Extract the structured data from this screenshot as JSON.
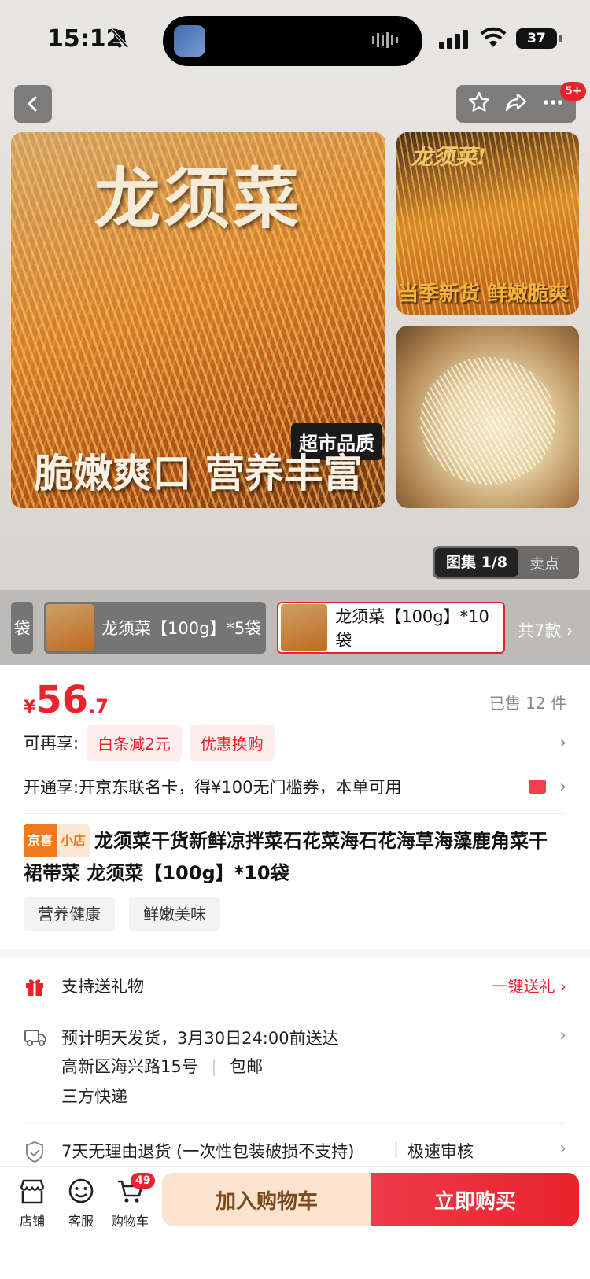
{
  "status_bar": {
    "time": "15:12",
    "battery": "37"
  },
  "header": {
    "badge": "5+"
  },
  "images": {
    "main_title": "龙须菜",
    "main_tag": "超市品质",
    "main_caption": "脆嫩爽口 营养丰富",
    "side1_title": "龙须菜!",
    "side1_caption": "当季新货 鲜嫩脆爽"
  },
  "gallery": {
    "active_label": "图集 1/8",
    "inactive_label": "卖点"
  },
  "sku": {
    "partial": "袋",
    "options": [
      "龙须菜【100g】*5袋",
      "龙须菜【100g】*10袋"
    ],
    "more": "共7款 ›"
  },
  "price": {
    "currency": "¥",
    "integer": "56",
    "decimal": ".7",
    "sold": "已售 12 件"
  },
  "promo": {
    "label": "可再享:",
    "chips": [
      "白条减2元",
      "优惠换购"
    ]
  },
  "membership": {
    "text": "开通享:开京东联名卡，得¥100无门槛券，本单可用"
  },
  "product": {
    "tag1": "京喜",
    "tag2": "小店",
    "title": "龙须菜干货新鲜凉拌菜石花菜海石花海草海藻鹿角菜干裙带菜 龙须菜【100g】*10袋",
    "tags": [
      "营养健康",
      "鲜嫩美味"
    ]
  },
  "services": {
    "gift_label": "支持送礼物",
    "gift_action": "一键送礼 ›",
    "delivery_line1": "预计明天发货，3月30日24:00前送达",
    "address": "高新区海兴路15号",
    "shipping": "包邮",
    "courier": "三方快递",
    "returns": "7天无理由退货 (一次性包装破损不支持)",
    "review": "极速审核"
  },
  "bottom": {
    "shop": "店铺",
    "service": "客服",
    "cart": "购物车",
    "cart_count": "49",
    "add_to_cart": "加入购物车",
    "buy_now": "立即购买"
  }
}
